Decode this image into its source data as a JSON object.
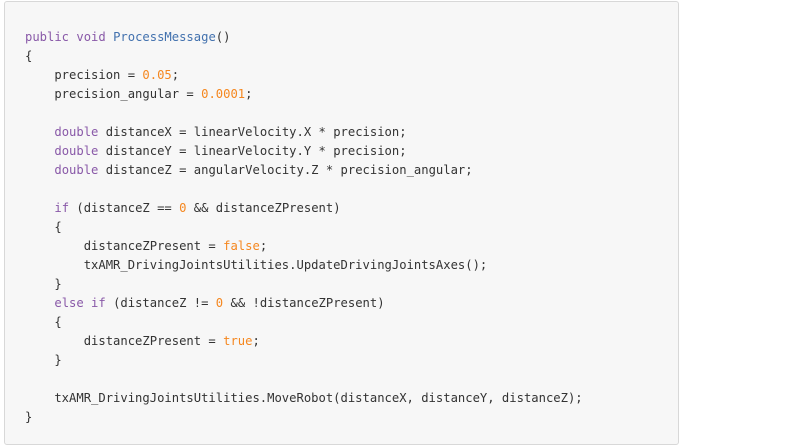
{
  "code": {
    "language": "csharp",
    "colors": {
      "background": "#f7f7f7",
      "border": "#d8d8d8",
      "text": "#333333",
      "keyword": "#8959a8",
      "function": "#4271ae",
      "number": "#f5871f"
    },
    "lines": [
      [
        {
          "t": "kw",
          "v": "public void "
        },
        {
          "t": "fn",
          "v": "ProcessMessage"
        },
        {
          "t": "txt",
          "v": "()"
        }
      ],
      [
        {
          "t": "txt",
          "v": "{"
        }
      ],
      [
        {
          "t": "txt",
          "v": "    precision = "
        },
        {
          "t": "num",
          "v": "0.05"
        },
        {
          "t": "txt",
          "v": ";"
        }
      ],
      [
        {
          "t": "txt",
          "v": "    precision_angular = "
        },
        {
          "t": "num",
          "v": "0.0001"
        },
        {
          "t": "txt",
          "v": ";"
        }
      ],
      [],
      [
        {
          "t": "txt",
          "v": "    "
        },
        {
          "t": "kw",
          "v": "double"
        },
        {
          "t": "txt",
          "v": " distanceX = linearVelocity.X * precision;"
        }
      ],
      [
        {
          "t": "txt",
          "v": "    "
        },
        {
          "t": "kw",
          "v": "double"
        },
        {
          "t": "txt",
          "v": " distanceY = linearVelocity.Y * precision;"
        }
      ],
      [
        {
          "t": "txt",
          "v": "    "
        },
        {
          "t": "kw",
          "v": "double"
        },
        {
          "t": "txt",
          "v": " distanceZ = angularVelocity.Z * precision_angular;"
        }
      ],
      [],
      [
        {
          "t": "txt",
          "v": "    "
        },
        {
          "t": "kw",
          "v": "if"
        },
        {
          "t": "txt",
          "v": " (distanceZ == "
        },
        {
          "t": "num",
          "v": "0"
        },
        {
          "t": "txt",
          "v": " && distanceZPresent)"
        }
      ],
      [
        {
          "t": "txt",
          "v": "    {"
        }
      ],
      [
        {
          "t": "txt",
          "v": "        distanceZPresent = "
        },
        {
          "t": "lit",
          "v": "false"
        },
        {
          "t": "txt",
          "v": ";"
        }
      ],
      [
        {
          "t": "txt",
          "v": "        txAMR_DrivingJointsUtilities.UpdateDrivingJointsAxes();"
        }
      ],
      [
        {
          "t": "txt",
          "v": "    }"
        }
      ],
      [
        {
          "t": "txt",
          "v": "    "
        },
        {
          "t": "kw",
          "v": "else if"
        },
        {
          "t": "txt",
          "v": " (distanceZ != "
        },
        {
          "t": "num",
          "v": "0"
        },
        {
          "t": "txt",
          "v": " && !distanceZPresent)"
        }
      ],
      [
        {
          "t": "txt",
          "v": "    {"
        }
      ],
      [
        {
          "t": "txt",
          "v": "        distanceZPresent = "
        },
        {
          "t": "lit",
          "v": "true"
        },
        {
          "t": "txt",
          "v": ";"
        }
      ],
      [
        {
          "t": "txt",
          "v": "    }"
        }
      ],
      [],
      [
        {
          "t": "txt",
          "v": "    txAMR_DrivingJointsUtilities.MoveRobot(distanceX, distanceY, distanceZ);"
        }
      ],
      [
        {
          "t": "txt",
          "v": "}"
        }
      ]
    ]
  }
}
